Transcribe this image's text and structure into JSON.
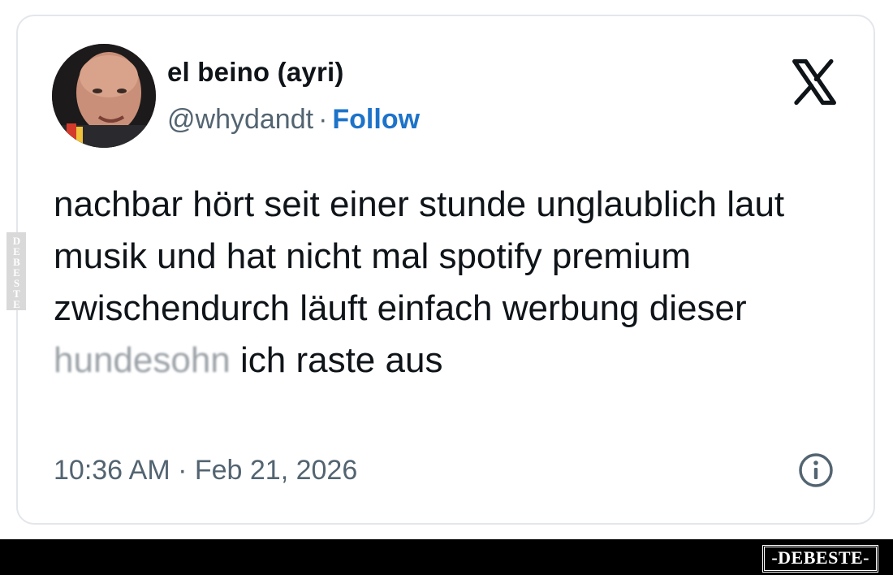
{
  "tweet": {
    "author": {
      "display_name": "el beino (ayri)",
      "handle": "@whydandt",
      "separator": "·",
      "follow_label": "Follow"
    },
    "text": {
      "before_censored": "nachbar hört seit einer stunde unglaublich laut musik und hat nicht mal spotify premium zwischendurch läuft einfach werbung dieser ",
      "censored_word": "hundesohn",
      "after_censored": " ich raste aus"
    },
    "timestamp": "10:36 AM · Feb 21, 2026",
    "icons": {
      "platform": "x-logo-icon",
      "info": "info-icon"
    }
  },
  "watermarks": {
    "side": "DEBESTE",
    "footer": "-DEBESTE-"
  },
  "colors": {
    "follow": "#1d73c9",
    "text": "#0f1419",
    "secondary": "#536471",
    "card_border": "#e3e6ea",
    "footer_bg": "#000000"
  }
}
